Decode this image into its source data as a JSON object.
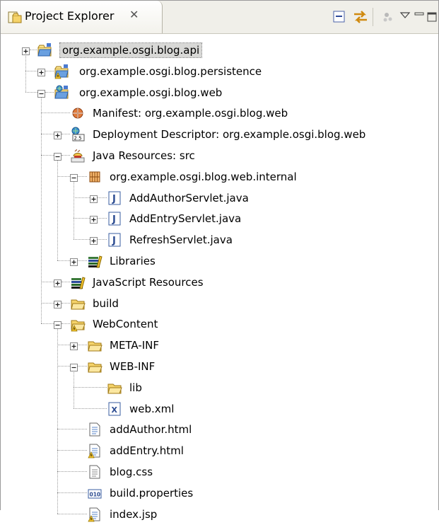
{
  "view": {
    "title": "Project Explorer",
    "close_glyph": "✕",
    "toolbar": {
      "collapse_all_icon": "collapse-all-icon",
      "link_editor_icon": "link-with-editor-icon",
      "filter_icon": "filter-icon",
      "view_menu_icon": "view-menu-icon",
      "minimize_icon": "minimize-icon",
      "maximize_icon": "maximize-icon"
    }
  },
  "tree": [
    {
      "id": "api",
      "label": "org.example.osgi.blog.api",
      "icon": "plugin-project-icon",
      "expander": "plus",
      "selected": true
    },
    {
      "id": "persistence",
      "label": "org.example.osgi.blog.persistence",
      "icon": "plugin-project-warning-icon",
      "expander": "plus"
    },
    {
      "id": "web",
      "label": "org.example.osgi.blog.web",
      "icon": "web-plugin-project-icon",
      "expander": "minus"
    },
    {
      "id": "manifest",
      "label": "Manifest: org.example.osgi.blog.web",
      "icon": "manifest-icon",
      "expander": "none"
    },
    {
      "id": "deployment",
      "label": "Deployment Descriptor: org.example.osgi.blog.web",
      "icon": "deployment-descriptor-icon",
      "expander": "plus"
    },
    {
      "id": "java_resources",
      "label": "Java Resources: src",
      "icon": "java-resources-icon",
      "expander": "minus"
    },
    {
      "id": "package",
      "label": "org.example.osgi.blog.web.internal",
      "icon": "package-icon",
      "expander": "minus"
    },
    {
      "id": "add_author_servlet",
      "label": "AddAuthorServlet.java",
      "icon": "java-file-icon",
      "expander": "plus"
    },
    {
      "id": "add_entry_servlet",
      "label": "AddEntryServlet.java",
      "icon": "java-file-icon",
      "expander": "plus"
    },
    {
      "id": "refresh_servlet",
      "label": "RefreshServlet.java",
      "icon": "java-file-icon",
      "expander": "plus"
    },
    {
      "id": "libraries",
      "label": "Libraries",
      "icon": "libraries-icon",
      "expander": "plus"
    },
    {
      "id": "js_resources",
      "label": "JavaScript Resources",
      "icon": "libraries-icon",
      "expander": "plus"
    },
    {
      "id": "build",
      "label": "build",
      "icon": "folder-icon",
      "expander": "plus"
    },
    {
      "id": "webcontent",
      "label": "WebContent",
      "icon": "folder-warning-icon",
      "expander": "minus"
    },
    {
      "id": "meta_inf",
      "label": "META-INF",
      "icon": "folder-icon",
      "expander": "plus"
    },
    {
      "id": "web_inf",
      "label": "WEB-INF",
      "icon": "folder-icon",
      "expander": "minus"
    },
    {
      "id": "lib",
      "label": "lib",
      "icon": "folder-icon",
      "expander": "none"
    },
    {
      "id": "web_xml",
      "label": "web.xml",
      "icon": "xml-file-icon",
      "expander": "none"
    },
    {
      "id": "add_author_html",
      "label": "addAuthor.html",
      "icon": "html-file-icon",
      "expander": "none"
    },
    {
      "id": "add_entry_html",
      "label": "addEntry.html",
      "icon": "html-file-warning-icon",
      "expander": "none"
    },
    {
      "id": "blog_css",
      "label": "blog.css",
      "icon": "css-file-icon",
      "expander": "none"
    },
    {
      "id": "build_properties",
      "label": "build.properties",
      "icon": "properties-file-icon",
      "expander": "none"
    },
    {
      "id": "index_jsp",
      "label": "index.jsp",
      "icon": "jsp-file-warning-icon",
      "expander": "none"
    }
  ]
}
